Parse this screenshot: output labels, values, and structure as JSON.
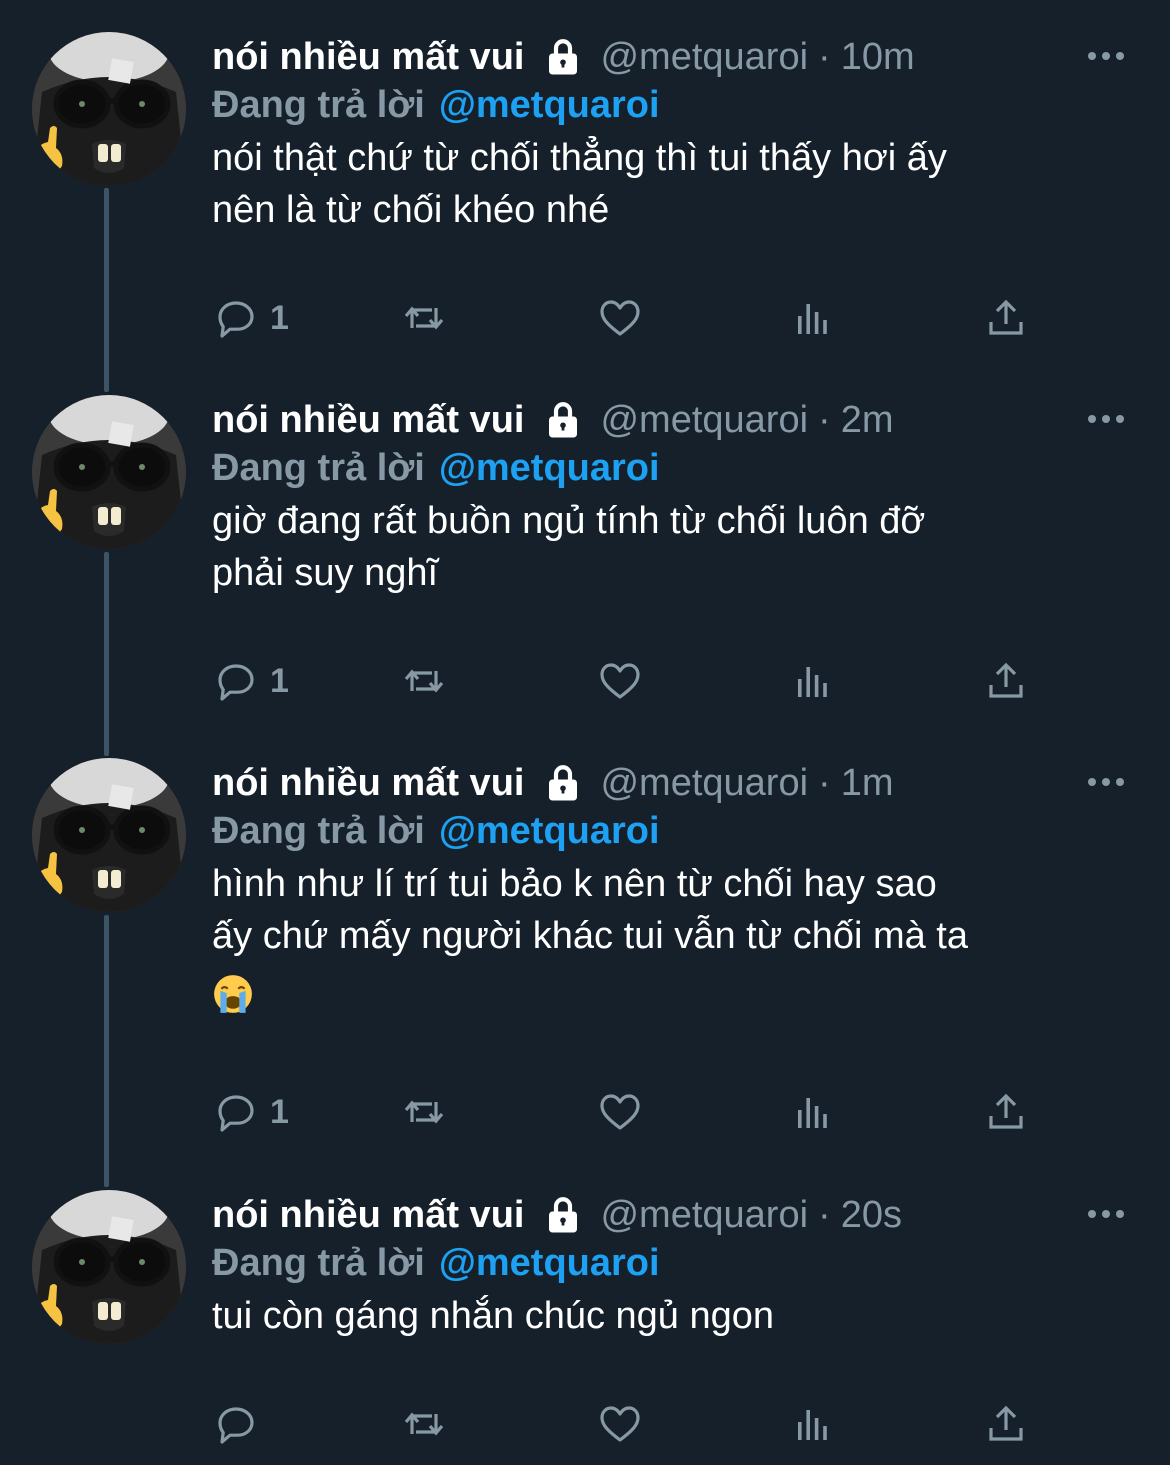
{
  "tweets": [
    {
      "name": "nói nhiều mất vui",
      "handle": "@metquaroi",
      "separator": "·",
      "time": "10m",
      "replying_label": "Đang trả lời",
      "replying_to": "@metquaroi",
      "text_lines": [
        "nói thật chứ từ chối thẳng thì tui thấy hơi ấy",
        "nên là từ chối khéo nhé"
      ],
      "reply_count": "1",
      "has_emoji": false
    },
    {
      "name": "nói nhiều mất vui",
      "handle": "@metquaroi",
      "separator": "·",
      "time": "2m",
      "replying_label": "Đang trả lời",
      "replying_to": "@metquaroi",
      "text_lines": [
        "giờ đang rất buồn ngủ tính từ chối luôn đỡ",
        "phải suy nghĩ"
      ],
      "reply_count": "1",
      "has_emoji": false
    },
    {
      "name": "nói nhiều mất vui",
      "handle": "@metquaroi",
      "separator": "·",
      "time": "1m",
      "replying_label": "Đang trả lời",
      "replying_to": "@metquaroi",
      "text_lines": [
        "hình như lí trí tui bảo k nên từ chối hay sao",
        "ấy chứ mấy người khác tui vẫn từ chối mà ta"
      ],
      "emoji": "loudly-crying-face",
      "reply_count": "1",
      "has_emoji": true
    },
    {
      "name": "nói nhiều mất vui",
      "handle": "@metquaroi",
      "separator": "·",
      "time": "20s",
      "replying_label": "Đang trả lời",
      "replying_to": "@metquaroi",
      "text_lines": [
        "tui còn gáng nhắn chúc ngủ ngon"
      ],
      "reply_count": "",
      "has_emoji": false
    }
  ],
  "icons": {
    "lock": "lock-icon",
    "more": "more-icon",
    "reply": "reply-icon",
    "retweet": "retweet-icon",
    "like": "like-icon",
    "analytics": "analytics-icon",
    "share": "share-icon",
    "avatar": "cat-with-glasses-avatar"
  },
  "colors": {
    "background": "#15202b",
    "text": "#ffffff",
    "secondary": "#8899a6",
    "mention": "#1da1f2",
    "thread_line": "#3d5466"
  }
}
